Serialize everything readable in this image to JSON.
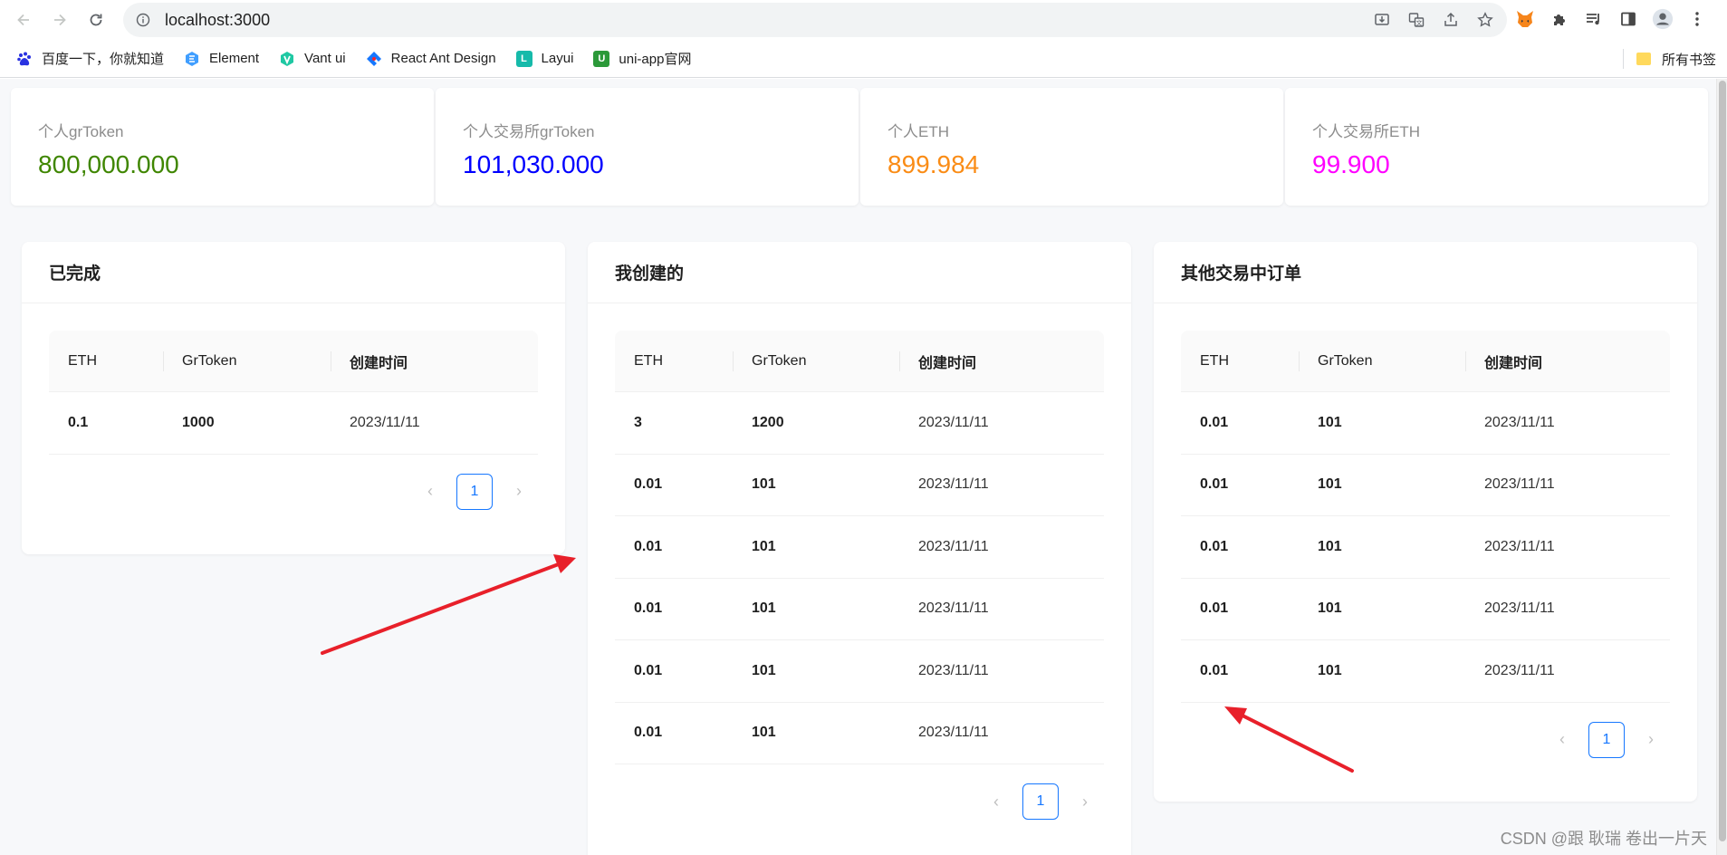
{
  "browser": {
    "url": "localhost:3000",
    "bookmarks": [
      {
        "label": "百度一下，你就知道",
        "icon": "baidu-icon",
        "color": "#2932e1"
      },
      {
        "label": "Element",
        "icon": "element-icon",
        "color": "#409eff"
      },
      {
        "label": "Vant ui",
        "icon": "vant-icon",
        "color": "#07c160"
      },
      {
        "label": "React Ant Design",
        "icon": "antd-icon",
        "color": "#f5222d"
      },
      {
        "label": "Layui",
        "icon": "layui-icon",
        "color": "#16baaa"
      },
      {
        "label": "uni-app官网",
        "icon": "uniapp-icon",
        "color": "#2b9939"
      }
    ],
    "all_bookmarks": "所有书签"
  },
  "stats": [
    {
      "title": "个人grToken",
      "value": "800,000.000",
      "color": "#3f8600"
    },
    {
      "title": "个人交易所grToken",
      "value": "101,030.000",
      "color": "#0000ff"
    },
    {
      "title": "个人ETH",
      "value": "899.984",
      "color": "#fa8c16"
    },
    {
      "title": "个人交易所ETH",
      "value": "99.900",
      "color": "#ff00ff"
    }
  ],
  "columns": {
    "eth": "ETH",
    "grtoken": "GrToken",
    "created": "创建时间"
  },
  "cards": {
    "done": {
      "title": "已完成",
      "rows": [
        {
          "eth": "0.1",
          "grtoken": "1000",
          "created": "2023/11/11"
        }
      ],
      "page": "1"
    },
    "mine": {
      "title": "我创建的",
      "rows": [
        {
          "eth": "3",
          "grtoken": "1200",
          "created": "2023/11/11"
        },
        {
          "eth": "0.01",
          "grtoken": "101",
          "created": "2023/11/11"
        },
        {
          "eth": "0.01",
          "grtoken": "101",
          "created": "2023/11/11"
        },
        {
          "eth": "0.01",
          "grtoken": "101",
          "created": "2023/11/11"
        },
        {
          "eth": "0.01",
          "grtoken": "101",
          "created": "2023/11/11"
        },
        {
          "eth": "0.01",
          "grtoken": "101",
          "created": "2023/11/11"
        }
      ],
      "page": "1"
    },
    "others": {
      "title": "其他交易中订单",
      "rows": [
        {
          "eth": "0.01",
          "grtoken": "101",
          "created": "2023/11/11"
        },
        {
          "eth": "0.01",
          "grtoken": "101",
          "created": "2023/11/11"
        },
        {
          "eth": "0.01",
          "grtoken": "101",
          "created": "2023/11/11"
        },
        {
          "eth": "0.01",
          "grtoken": "101",
          "created": "2023/11/11"
        },
        {
          "eth": "0.01",
          "grtoken": "101",
          "created": "2023/11/11"
        }
      ],
      "page": "1"
    }
  },
  "watermark": "CSDN @跟 耿瑞 卷出一片天",
  "annotation_color": "#e8202a"
}
